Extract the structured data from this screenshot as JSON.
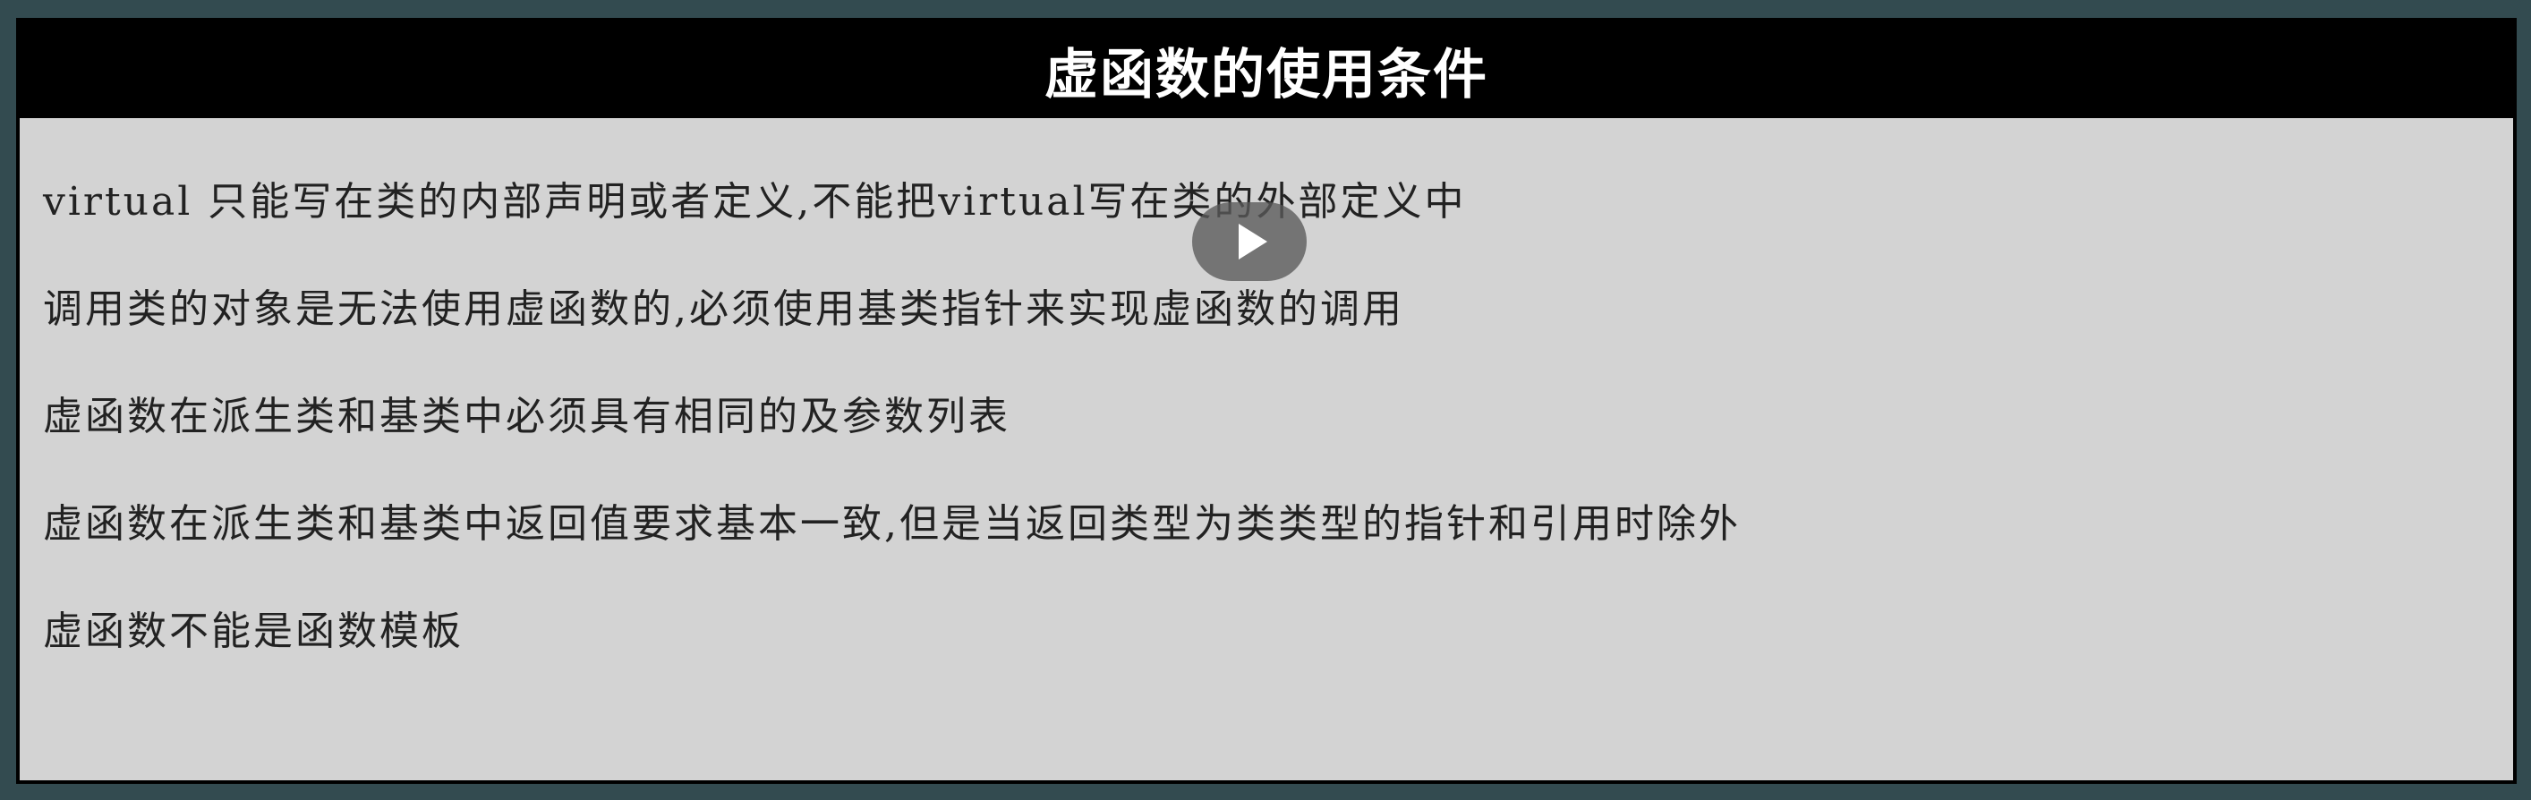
{
  "slide": {
    "title": "虚函数的使用条件",
    "lines": [
      "virtual 只能写在类的内部声明或者定义,不能把virtual写在类的外部定义中",
      "调用类的对象是无法使用虚函数的,必须使用基类指针来实现虚函数的调用",
      "虚函数在派生类和基类中必须具有相同的及参数列表",
      "虚函数在派生类和基类中返回值要求基本一致,但是当返回类型为类类型的指针和引用时除外",
      "虚函数不能是函数模板"
    ]
  },
  "player": {
    "play_icon": "play-icon"
  },
  "colors": {
    "background": "#334b50",
    "slide_background": "#d3d3d3",
    "title_bar": "#000000",
    "title_text": "#ffffff"
  }
}
